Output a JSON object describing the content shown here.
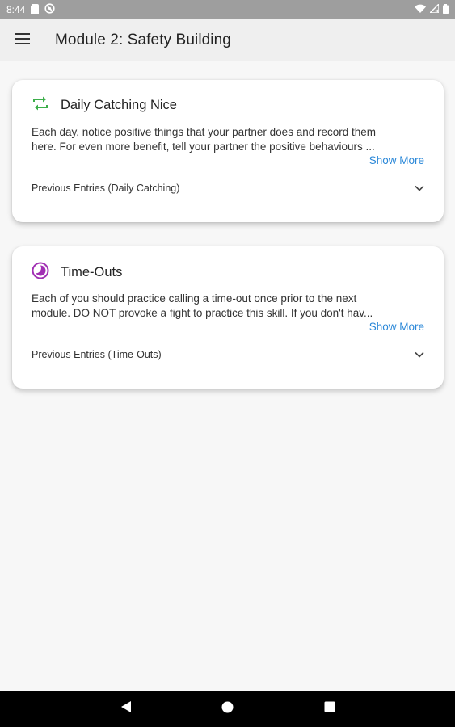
{
  "status_bar": {
    "time": "8:44",
    "icons": [
      "sd-card-icon",
      "no-sync-icon",
      "wifi-icon",
      "signal-icon",
      "battery-icon"
    ]
  },
  "app_bar": {
    "menu_icon": "hamburger-menu-icon",
    "title": "Module 2: Safety Building"
  },
  "cards": [
    {
      "icon": "repeat-arrows-icon",
      "icon_color": "#3cae4a",
      "title": "Daily Catching Nice",
      "description_lines": [
        "Each day, notice positive things that your partner does and record them",
        "here. For even more benefit, tell your partner the positive behaviours ..."
      ],
      "show_more": "Show More",
      "entries_label": "Previous Entries (Daily Catching)"
    },
    {
      "icon": "moon-clock-icon",
      "icon_color": "#a12fb3",
      "title": "Time-Outs",
      "description_lines": [
        "Each of you should practice calling a time-out once prior to the next",
        "module. DO NOT provoke a fight to practice this skill. If you don't hav..."
      ],
      "show_more": "Show More",
      "entries_label": "Previous Entries (Time-Outs)"
    }
  ],
  "nav_bar": {
    "icons": [
      "back-icon",
      "home-icon",
      "recents-icon"
    ]
  },
  "colors": {
    "link": "#2b88d8",
    "app_bar_bg": "#efefef",
    "status_bar_bg": "#9e9e9e",
    "page_bg": "#f7f7f7"
  }
}
